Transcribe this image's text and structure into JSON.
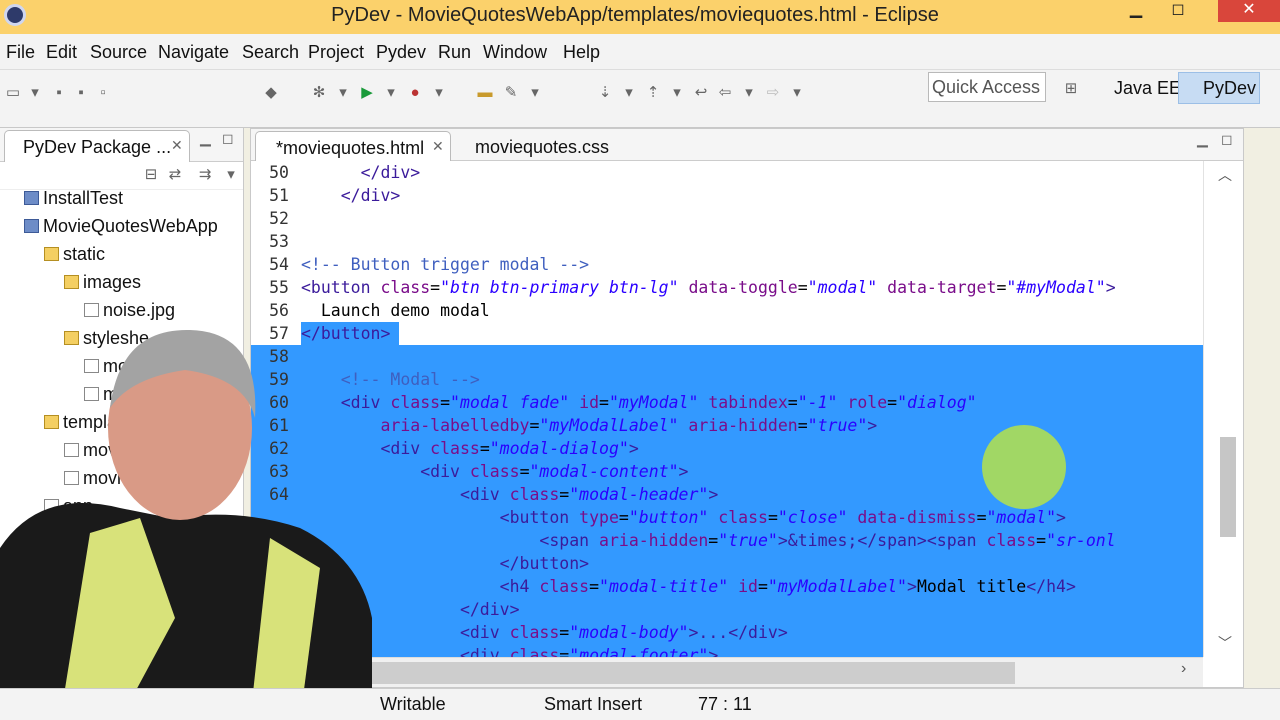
{
  "window": {
    "title": "PyDev - MovieQuotesWebApp/templates/moviequotes.html - Eclipse"
  },
  "menu": [
    "File",
    "Edit",
    "Source",
    "Navigate",
    "Search",
    "Project",
    "Pydev",
    "Run",
    "Window",
    "Help"
  ],
  "toolbar": {
    "quick_access": "Quick Access",
    "perspective_javaee": "Java EE",
    "perspective_pydev": "PyDev"
  },
  "explorer": {
    "tab_label": "PyDev Package ...",
    "items": [
      "InstallTest",
      "MovieQuotesWebApp",
      "static",
      "images",
      "noise.jpg",
      "styleshe",
      "mo",
      "mo",
      "templat",
      "moviec",
      "movie",
      "app"
    ]
  },
  "editor": {
    "tabs": [
      "*moviequotes.html",
      "moviequotes.css"
    ],
    "line_numbers": [
      "50",
      "51",
      "52",
      "53",
      "54",
      "55",
      "56",
      "57",
      "58",
      "59",
      "60",
      "61",
      "62",
      "63",
      "64",
      "",
      "",
      "",
      "",
      "",
      "",
      ""
    ]
  },
  "status": {
    "writable": "Writable",
    "insert_mode": "Smart Insert",
    "position": "77 : 11"
  },
  "colors": {
    "selection": "#3399ff",
    "titlebar": "#fbd16b"
  }
}
